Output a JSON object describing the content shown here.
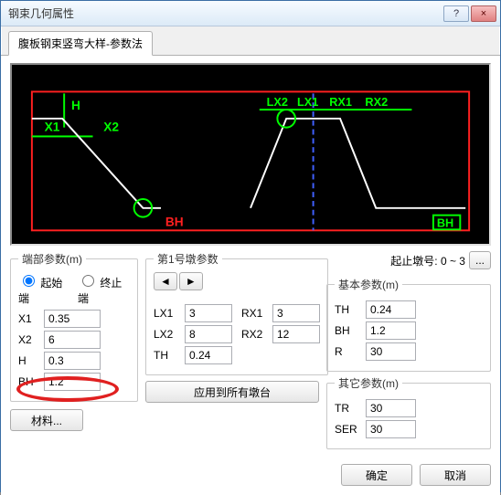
{
  "window": {
    "title": "钢束几何属性",
    "help": "?",
    "close": "×"
  },
  "tab": {
    "label": "腹板钢束竖弯大样-参数法"
  },
  "diagram_labels": {
    "H": "H",
    "X1": "X1",
    "X2": "X2",
    "BH_left": "BH",
    "LX2": "LX2",
    "LX1": "LX1",
    "RX1": "RX1",
    "RX2": "RX2",
    "BH_right": "BH"
  },
  "end_params": {
    "legend": "端部参数(m)",
    "radio_start": "起始端",
    "radio_end": "终止端",
    "X1_label": "X1",
    "X1": "0.35",
    "X2_label": "X2",
    "X2": "6",
    "H_label": "H",
    "H": "0.3",
    "BH_label": "BH",
    "BH": "1.2",
    "material_btn": "材料..."
  },
  "pier_params": {
    "legend": "第1号墩参数",
    "prev": "◄",
    "next": "►",
    "LX1_label": "LX1",
    "LX1": "3",
    "RX1_label": "RX1",
    "RX1": "3",
    "LX2_label": "LX2",
    "LX2": "8",
    "RX2_label": "RX2",
    "RX2": "12",
    "TH_label": "TH",
    "TH": "0.24",
    "apply_btn": "应用到所有墩台"
  },
  "range": {
    "label": "起止墩号: 0 ~ 3",
    "more": "..."
  },
  "basic_params": {
    "legend": "基本参数(m)",
    "TH_label": "TH",
    "TH": "0.24",
    "BH_label": "BH",
    "BH": "1.2",
    "R_label": "R",
    "R": "30"
  },
  "other_params": {
    "legend": "其它参数(m)",
    "TR_label": "TR",
    "TR": "30",
    "SER_label": "SER",
    "SER": "30"
  },
  "footer": {
    "ok": "确定",
    "cancel": "取消"
  }
}
